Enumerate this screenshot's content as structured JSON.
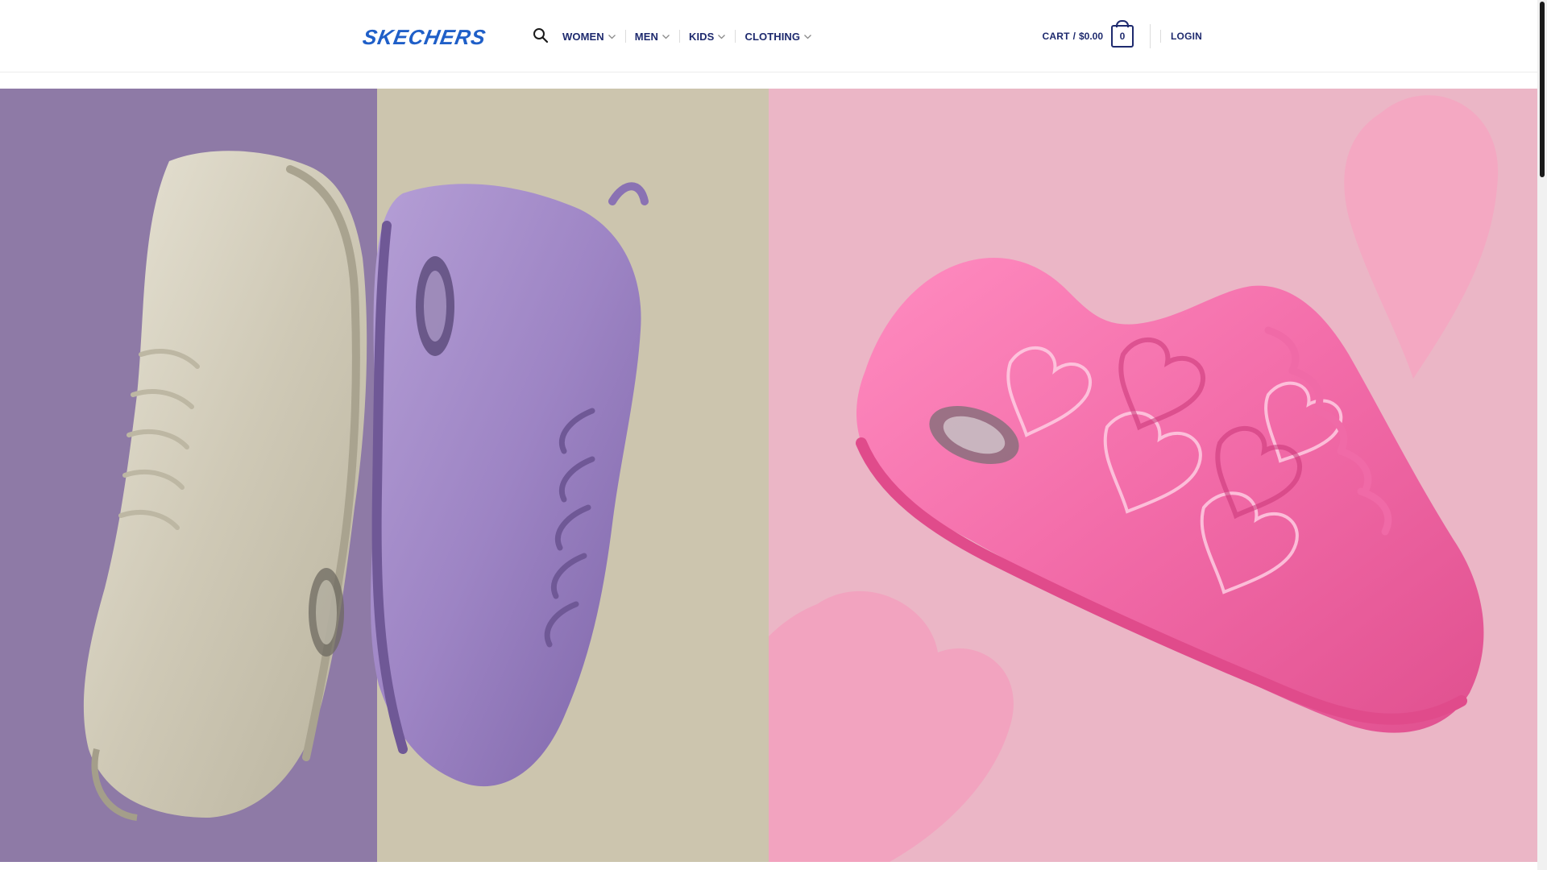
{
  "brand": {
    "name": "SKECHERS",
    "color": "#1f5fc8"
  },
  "nav": {
    "items": [
      {
        "label": "WOMEN"
      },
      {
        "label": "MEN"
      },
      {
        "label": "KIDS"
      },
      {
        "label": "CLOTHING"
      }
    ]
  },
  "cart": {
    "label": "CART",
    "separator": "/",
    "total": "$0.00",
    "count": "0"
  },
  "account": {
    "login_label": "LOGIN"
  },
  "colors": {
    "nav_text": "#1e2a6e",
    "hero_left_bg_a": "#8e7aa6",
    "hero_left_bg_b": "#ccc5ae",
    "hero_right_bg": "#ebb6c6",
    "shoe_pink": "#f26ba8"
  },
  "icons": [
    "search-icon",
    "chevron-down-icon",
    "cart-icon"
  ]
}
